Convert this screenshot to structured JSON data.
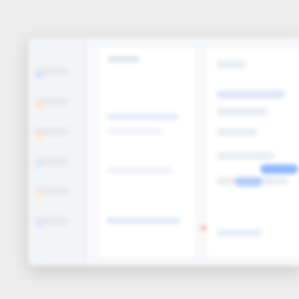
{
  "screen": {
    "title": "",
    "left_rail_items": [
      "",
      "",
      "",
      "",
      "",
      ""
    ],
    "list_items": [
      "",
      "",
      "",
      ""
    ],
    "content_rows": [
      "",
      "",
      "",
      "",
      "",
      ""
    ],
    "chips": [
      "",
      ""
    ],
    "badge": ""
  },
  "colors": {
    "accent": "#a9c6ff",
    "accent_dark": "#8cb4ff",
    "warning": "#ffb7b7",
    "rail": "#f3f4f6",
    "panel": "#ffffff"
  }
}
